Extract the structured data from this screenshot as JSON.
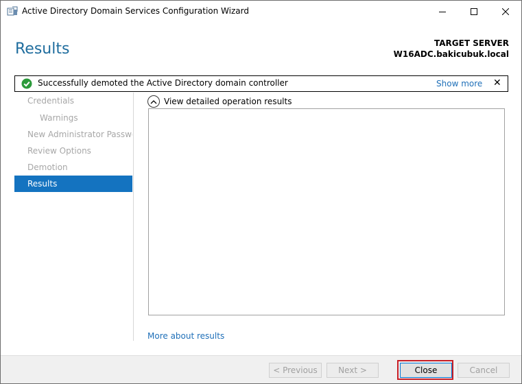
{
  "window": {
    "title": "Active Directory Domain Services Configuration Wizard",
    "controls": {
      "minimize": "minimize-icon",
      "maximize": "maximize-icon",
      "close": "close-icon"
    }
  },
  "header": {
    "page_title": "Results",
    "target_label": "TARGET SERVER",
    "target_name": "W16ADC.bakicubuk.local"
  },
  "banner": {
    "message": "Successfully demoted the Active Directory domain controller",
    "show_more": "Show more",
    "dismiss": "✕",
    "icon": "success-check-icon"
  },
  "nav": {
    "items": [
      {
        "label": "Credentials",
        "state": "inactive"
      },
      {
        "label": "Warnings",
        "state": "inactive"
      },
      {
        "label": "New Administrator Password",
        "state": "inactive"
      },
      {
        "label": "Review Options",
        "state": "inactive"
      },
      {
        "label": "Demotion",
        "state": "inactive"
      },
      {
        "label": "Results",
        "state": "active"
      }
    ]
  },
  "main": {
    "expander_label": "View detailed operation results",
    "more_link": "More about results"
  },
  "footer": {
    "previous": "< Previous",
    "next": "Next >",
    "close": "Close",
    "cancel": "Cancel"
  },
  "colors": {
    "title_blue": "#1f6d9e",
    "nav_active": "#1473c0",
    "link": "#1e6fb8",
    "highlight_red": "#c81d25",
    "success_green": "#2b9a3a"
  }
}
